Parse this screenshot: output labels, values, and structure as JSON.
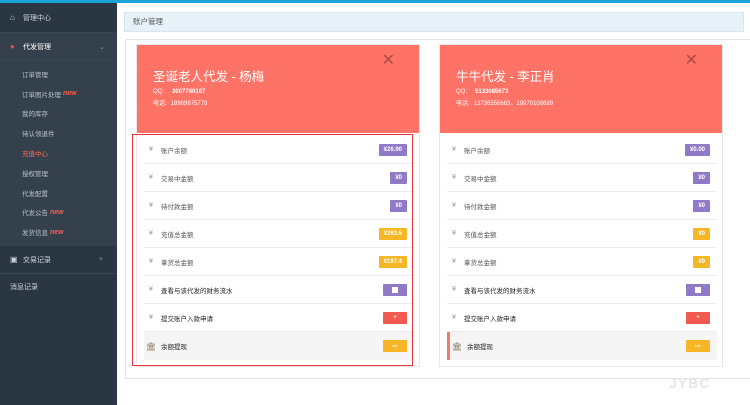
{
  "sidebar": {
    "home_label": "管理中心",
    "section_label": "代发管理",
    "sub_items": [
      {
        "label": "订单管理",
        "tag": ""
      },
      {
        "label": "订单图片处理",
        "tag": "new"
      },
      {
        "label": "我的库存",
        "tag": ""
      },
      {
        "label": "待认领退件",
        "tag": ""
      },
      {
        "label": "充值中心",
        "tag": ""
      },
      {
        "label": "授权管理",
        "tag": ""
      },
      {
        "label": "代发配置",
        "tag": ""
      },
      {
        "label": "代发公告",
        "tag": "new"
      },
      {
        "label": "发货信息",
        "tag": "new"
      }
    ],
    "transactions_label": "交易记录",
    "transactions_expand": "+",
    "messages_label": "消息记录"
  },
  "page_title": "账户管理",
  "cards": [
    {
      "title": "圣诞老人代发 - 杨梅",
      "qq_label": "QQ:",
      "qq": "3007780167",
      "phone_label": "电话:",
      "phone": "18969675779",
      "close": "✕",
      "rows": {
        "balance_label": "账户余额",
        "balance": "¥26.90",
        "trading_label": "交易中金额",
        "trading": "¥0",
        "pending_label": "待付款金额",
        "pending": "¥0",
        "recharge_label": "充值总金额",
        "recharge": "¥263.5",
        "goods_label": "拿货总金额",
        "goods": "¥197.4",
        "flow_label": "查看与该代发的财务流水",
        "apply_label": "提交账户入款申请",
        "apply_btn": "+",
        "withdraw_label": "余额提现",
        "withdraw_btn": "⇨"
      }
    },
    {
      "title": "牛牛代发 - 李正肖",
      "qq_label": "QQ:",
      "qq": "5133085673",
      "phone_label": "电话:",
      "phone": "13736556663，19970108689",
      "close": "✕",
      "rows": {
        "balance_label": "账户余额",
        "balance": "¥0.00",
        "trading_label": "交易中金额",
        "trading": "¥0",
        "pending_label": "待付款金额",
        "pending": "¥0",
        "recharge_label": "充值总金额",
        "recharge": "¥0",
        "goods_label": "拿货总金额",
        "goods": "¥0",
        "flow_label": "查看与该代发的财务流水",
        "apply_label": "提交账户入款申请",
        "apply_btn": "+",
        "withdraw_label": "余额提现",
        "withdraw_btn": "⇨"
      }
    }
  ],
  "watermark": "JYBC",
  "colors": {
    "card_header": "#ff7266",
    "sidebar": "#2b3643",
    "active_text": "#ff6a5a",
    "highlight_box": "#e8343c"
  }
}
